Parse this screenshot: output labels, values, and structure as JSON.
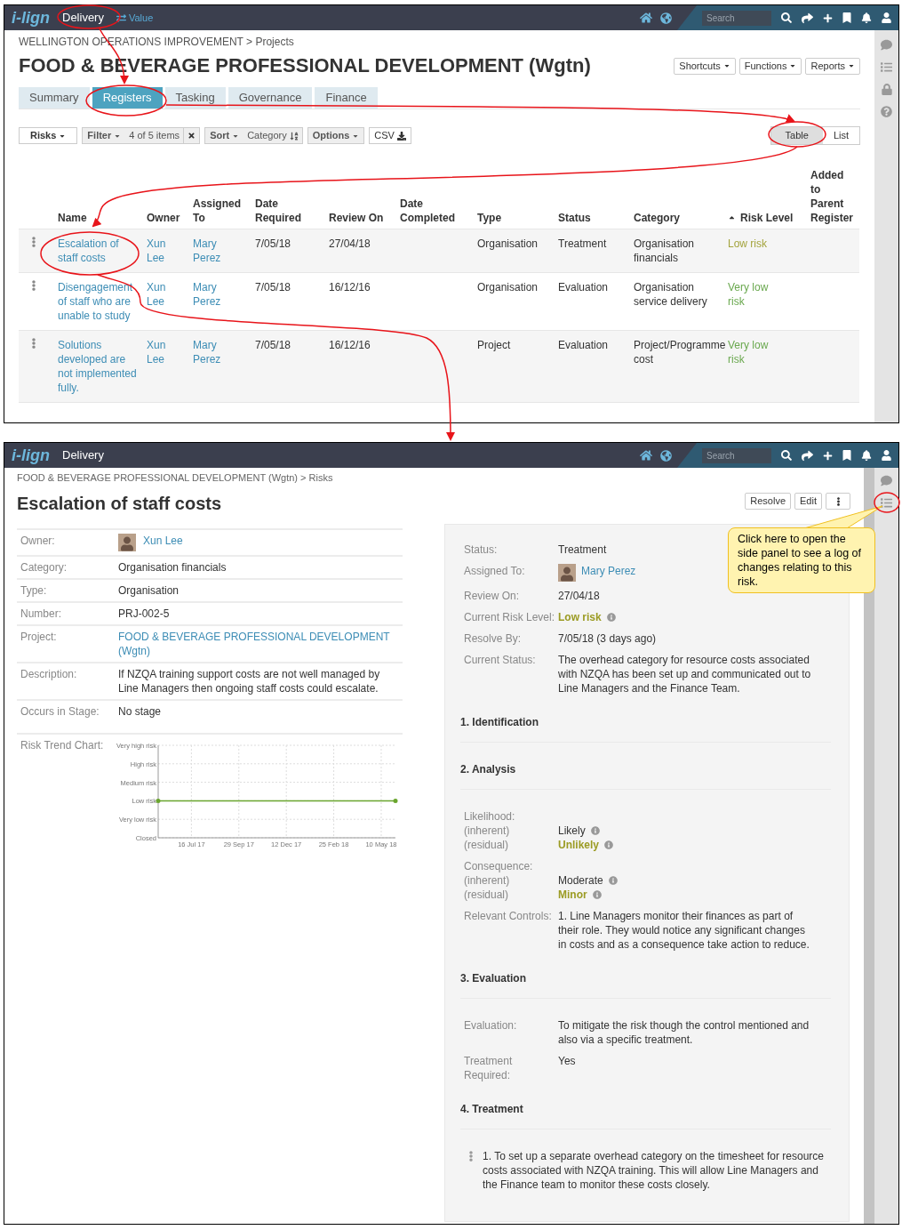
{
  "register_screen": {
    "navbar": {
      "logo": "i-lign",
      "module": "Delivery",
      "switch_link": "Value",
      "search_placeholder": "Search"
    },
    "breadcrumb": "WELLINGTON OPERATIONS IMPROVEMENT > Projects",
    "title": "FOOD & BEVERAGE PROFESSIONAL DEVELOPMENT (Wgtn)",
    "menus": [
      "Shortcuts",
      "Functions",
      "Reports"
    ],
    "tabs": [
      {
        "label": "Summary",
        "selected": false
      },
      {
        "label": "Registers",
        "selected": true
      },
      {
        "label": "Tasking",
        "selected": false
      },
      {
        "label": "Governance",
        "selected": false
      },
      {
        "label": "Finance",
        "selected": false
      }
    ],
    "toolbar": {
      "register_menu": "Risks",
      "filter": "Filter",
      "filter_count": "4 of 5 items",
      "sort": "Sort",
      "sort_field": "Category",
      "options": "Options",
      "export": "CSV"
    },
    "views": [
      {
        "label": "Table",
        "selected": true
      },
      {
        "label": "List",
        "selected": false
      }
    ],
    "table": {
      "columns": [
        {
          "label": "Name",
          "sorted": false
        },
        {
          "label": "Owner",
          "sorted": false
        },
        {
          "label": "Assigned To",
          "sorted": false
        },
        {
          "label": "Date Required",
          "sorted": false
        },
        {
          "label": "Review On",
          "sorted": false
        },
        {
          "label": "Date Completed",
          "sorted": false
        },
        {
          "label": "Type",
          "sorted": false
        },
        {
          "label": "Status",
          "sorted": false
        },
        {
          "label": "Category",
          "sorted": false
        },
        {
          "label": "Risk Level",
          "sorted": true
        },
        {
          "label": "Added to Parent Register",
          "sorted": false
        }
      ],
      "rows": [
        {
          "name": "Escalation of staff costs",
          "owner": "Xun Lee",
          "assigned_to": "Mary Perez",
          "date_required": "7/05/18",
          "review_on": "27/04/18",
          "type": "Organisation",
          "status": "Treatment",
          "category": "Organisation financials",
          "risk_level": "Low risk",
          "color": "#a3a33c"
        },
        {
          "name": "Disengagement of staff who are unable to study",
          "owner": "Xun Lee",
          "assigned_to": "Mary Perez",
          "date_required": "7/05/18",
          "review_on": "16/12/16",
          "type": "Organisation",
          "status": "Evaluation",
          "category": "Organisation service delivery",
          "risk_level": "Very low risk",
          "color": "#6aa84f"
        },
        {
          "name": "Solutions developed are not implemented fully.",
          "owner": "Xun Lee",
          "assigned_to": "Mary Perez",
          "date_required": "7/05/18",
          "review_on": "16/12/16",
          "type": "Project",
          "status": "Evaluation",
          "category": "Project/Programme cost",
          "risk_level": "Very low risk",
          "color": "#6aa84f"
        }
      ]
    }
  },
  "risk_screen": {
    "navbar": {
      "logo": "i-lign",
      "module": "Delivery",
      "search_placeholder": "Search"
    },
    "breadcrumb": "FOOD & BEVERAGE PROFESSIONAL DEVELOPMENT (Wgtn) > Risks",
    "title": "Escalation of staff costs",
    "actions": [
      "Resolve",
      "Edit"
    ],
    "details": [
      {
        "label": "Owner:",
        "value": "Xun Lee",
        "kind": "person"
      },
      {
        "label": "Category:",
        "value": "Organisation financials",
        "kind": "text"
      },
      {
        "label": "Type:",
        "value": "Organisation",
        "kind": "text"
      },
      {
        "label": "Number:",
        "value": "PRJ-002-5",
        "kind": "text"
      },
      {
        "label": "Project:",
        "value": "FOOD & BEVERAGE PROFESSIONAL DEVELOPMENT (Wgtn)",
        "kind": "link"
      },
      {
        "label": "Description:",
        "value": "If NZQA training support costs are not well managed by Line Managers then ongoing staff costs could escalate.",
        "kind": "text"
      },
      {
        "label": "Occurs in Stage:",
        "value": "No stage",
        "kind": "text"
      }
    ],
    "risk_trend": {
      "label": "Risk Trend Chart:",
      "y_labels": [
        "Very high risk",
        "High risk",
        "Medium risk",
        "Low risk",
        "Very low risk",
        "Closed"
      ],
      "x_labels": [
        "16 Jul 17",
        "29 Sep 17",
        "12 Dec 17",
        "25 Feb 18",
        "10 May 18"
      ]
    },
    "summary": [
      {
        "label": "Status:",
        "value": "Treatment",
        "kind": "text"
      },
      {
        "label": "Assigned To:",
        "value": "Mary Perez",
        "kind": "person"
      },
      {
        "label": "Review On:",
        "value": "27/04/18",
        "kind": "text"
      },
      {
        "label": "Current Risk Level:",
        "value": "Low risk",
        "kind": "rating",
        "color": "#9b9b23"
      },
      {
        "label": "Resolve By:",
        "value": "7/05/18 (3 days ago)",
        "kind": "text"
      },
      {
        "label": "Current Status:",
        "value": "The overhead category for resource costs associated with NZQA has been set up and communicated out to Line Managers and the Finance Team.",
        "kind": "text"
      }
    ],
    "sections": [
      {
        "title": "1. Identification"
      },
      {
        "title": "2. Analysis",
        "fields": [
          {
            "kind": "rated",
            "label": "Likelihood:",
            "ratings": [
              {
                "label": "(inherent)",
                "value": "Likely",
                "color": "#333333"
              },
              {
                "label": "(residual)",
                "value": "Unlikely",
                "color": "#9b9b23"
              }
            ]
          },
          {
            "kind": "rated",
            "label": "Consequence:",
            "ratings": [
              {
                "label": "(inherent)",
                "value": "Moderate",
                "color": "#333333"
              },
              {
                "label": "(residual)",
                "value": "Minor",
                "color": "#9b9b23"
              }
            ]
          },
          {
            "kind": "text",
            "label": "Relevant Controls:",
            "value": "1. Line Managers monitor their finances as part of their role. They would notice any significant changes in costs and as a consequence take action to reduce."
          }
        ]
      },
      {
        "title": "3. Evaluation",
        "fields": [
          {
            "kind": "text",
            "label": "Evaluation:",
            "value": "To mitigate the risk though the control mentioned and also via a specific treatment."
          },
          {
            "kind": "text",
            "label": "Treatment Required:",
            "value": "Yes"
          }
        ]
      },
      {
        "title": "4. Treatment",
        "treatments": [
          "1. To set up a separate overhead category on the timesheet for resource costs associated with NZQA training. This will allow Line Managers and the Finance team to monitor these costs closely."
        ]
      }
    ],
    "callout": "Click here to open the side panel to see a log of changes relating to this risk."
  }
}
